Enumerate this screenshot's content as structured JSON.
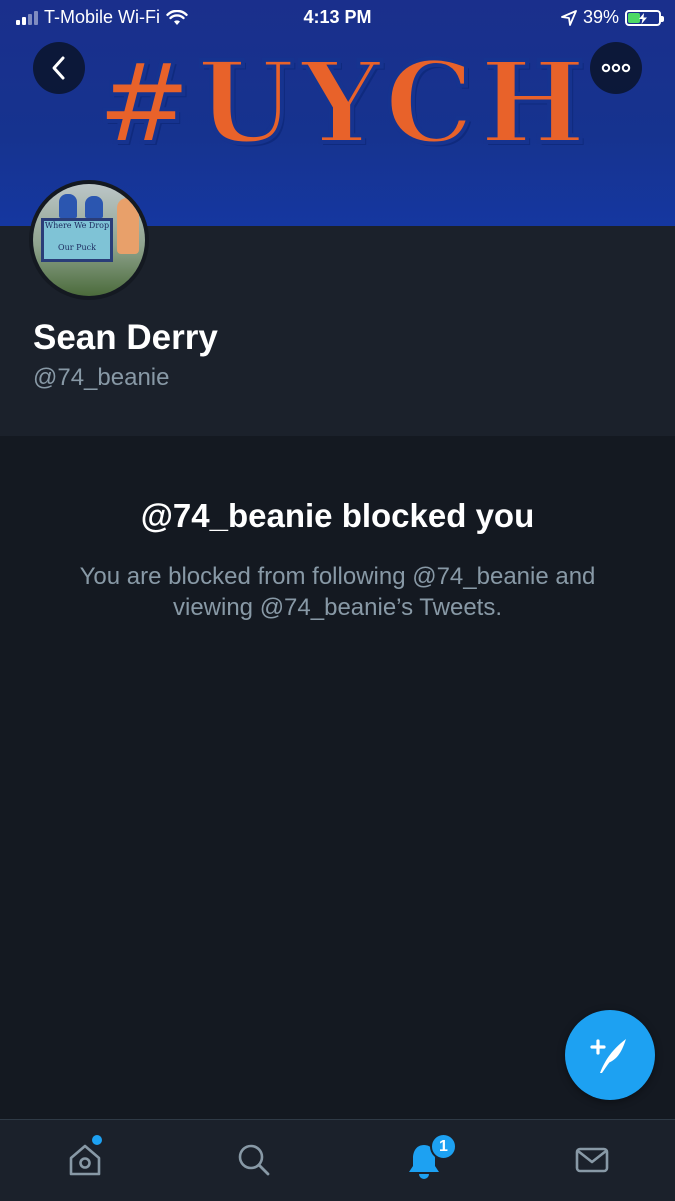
{
  "status_bar": {
    "carrier": "T-Mobile Wi-Fi",
    "time": "4:13 PM",
    "battery_percent": "39%",
    "battery_level": 0.39,
    "icons": [
      "signal-icon",
      "wifi-icon",
      "location-arrow-icon",
      "battery-charging-icon"
    ]
  },
  "header": {
    "banner_text": "#UYCH",
    "back_icon": "chevron-left-icon",
    "more_icon": "more-horizontal-icon"
  },
  "avatar_sign": {
    "line1": "Where We Drop",
    "line2": "Our Puck"
  },
  "profile": {
    "name": "Sean Derry",
    "handle": "@74_beanie"
  },
  "blocked": {
    "title": "@74_beanie blocked you",
    "description": "You are blocked from following @74_beanie and viewing @74_beanie’s Tweets."
  },
  "compose": {
    "icon": "compose-tweet-icon"
  },
  "bottom_nav": {
    "items": [
      "home-icon",
      "search-icon",
      "notifications-icon",
      "messages-icon"
    ],
    "notification_count": "1"
  },
  "colors": {
    "accent": "#1da1f2",
    "banner_blue": "#16338f",
    "banner_orange": "#e8622a",
    "background": "#141921",
    "secondary_text": "#8899a6"
  }
}
